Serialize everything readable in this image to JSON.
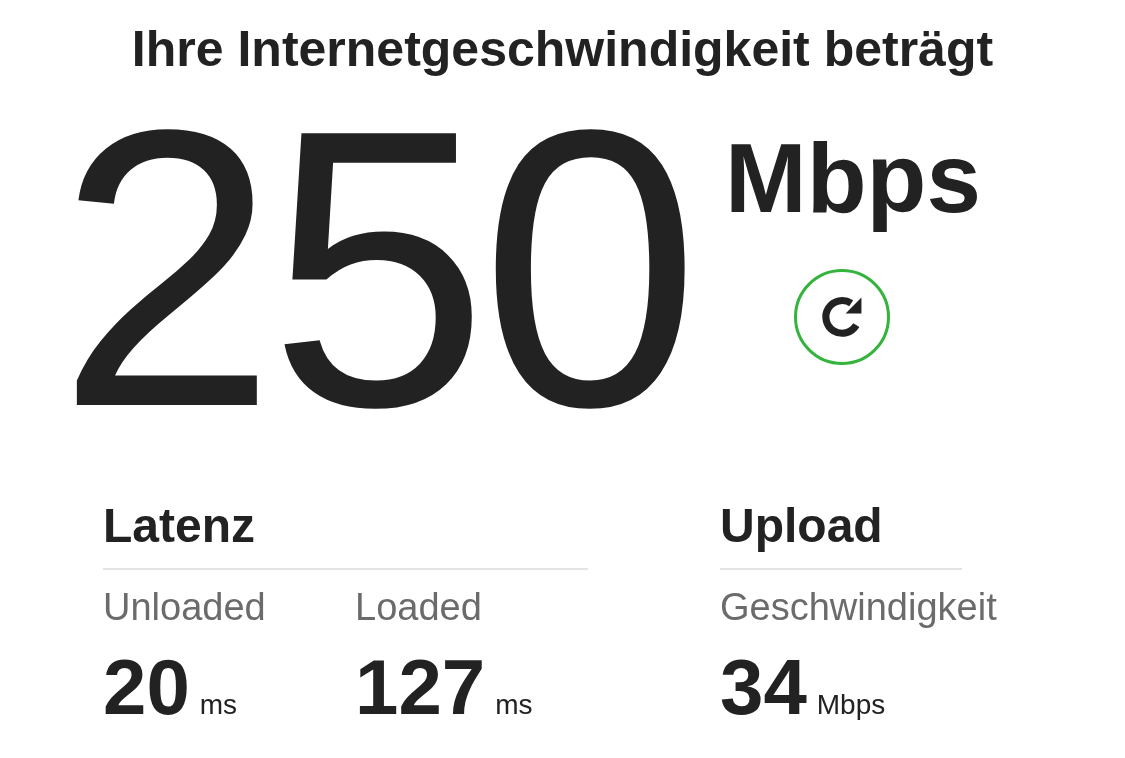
{
  "title": "Ihre Internetgeschwindigkeit beträgt",
  "speed": {
    "value": "250",
    "unit": "Mbps"
  },
  "sections": [
    {
      "heading": "Latenz",
      "metrics": [
        {
          "label": "Unloaded",
          "value": "20",
          "unit": "ms"
        },
        {
          "label": "Loaded",
          "value": "127",
          "unit": "ms"
        }
      ]
    },
    {
      "heading": "Upload",
      "metrics": [
        {
          "label": "Geschwindigkeit",
          "value": "34",
          "unit": "Mbps"
        }
      ]
    }
  ]
}
